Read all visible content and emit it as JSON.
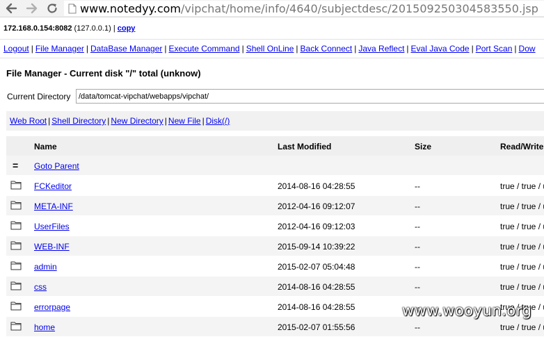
{
  "browser": {
    "back_icon": "arrow-left-icon",
    "forward_icon": "arrow-right-icon",
    "reload_icon": "reload-icon",
    "page_icon": "page-icon",
    "url_host": "www.notedyy.com",
    "url_path": "/vipchat/home/info/4640/subjectdesc/201509250304583550.jsp"
  },
  "host": {
    "server": "172.168.0.154:8082",
    "local_ip": "(127.0.0.1)",
    "divider": "|",
    "copy_label": "copy"
  },
  "menu": {
    "items": [
      "Logout",
      "File Manager",
      "DataBase Manager",
      "Execute Command",
      "Shell OnLine",
      "Back Connect",
      "Java Reflect",
      "Eval Java Code",
      "Port Scan",
      "Dow"
    ]
  },
  "file_manager": {
    "title": "File Manager - Current disk \"/\" total (unknow)",
    "current_dir_label": "Current Directory",
    "current_dir_value": "/data/tomcat-vipchat/webapps/vipchat/",
    "quick_links": [
      "Web Root",
      "Shell Directory",
      "New Directory",
      "New File",
      "Disk(/)"
    ]
  },
  "table": {
    "headers": {
      "name": "Name",
      "last_modified": "Last Modified",
      "size": "Size",
      "read_write": "Read/Write"
    },
    "parent_row": {
      "symbol": "=",
      "label": "Goto Parent"
    },
    "rows": [
      {
        "icon": "folder-icon",
        "name": "FCKeditor",
        "modified": "2014-08-16 04:28:55",
        "size": "--",
        "rw": "true / true / u"
      },
      {
        "icon": "folder-icon",
        "name": "META-INF",
        "modified": "2012-04-16 09:12:07",
        "size": "--",
        "rw": "true / true / u"
      },
      {
        "icon": "folder-icon",
        "name": "UserFiles",
        "modified": "2012-04-16 09:12:03",
        "size": "--",
        "rw": "true / true / u"
      },
      {
        "icon": "folder-icon",
        "name": "WEB-INF",
        "modified": "2015-09-14 10:39:22",
        "size": "--",
        "rw": "true / true / u"
      },
      {
        "icon": "folder-icon",
        "name": "admin",
        "modified": "2015-02-07 05:04:48",
        "size": "--",
        "rw": "true / true / u"
      },
      {
        "icon": "folder-icon",
        "name": "css",
        "modified": "2014-08-16 04:28:55",
        "size": "--",
        "rw": "true / true / u"
      },
      {
        "icon": "folder-icon",
        "name": "errorpage",
        "modified": "2014-08-16 04:28:55",
        "size": "--",
        "rw": "true / true / u"
      },
      {
        "icon": "folder-icon",
        "name": "home",
        "modified": "2015-02-07 01:55:56",
        "size": "--",
        "rw": "true / true / u"
      }
    ]
  },
  "watermark": "www.wooyun.org"
}
